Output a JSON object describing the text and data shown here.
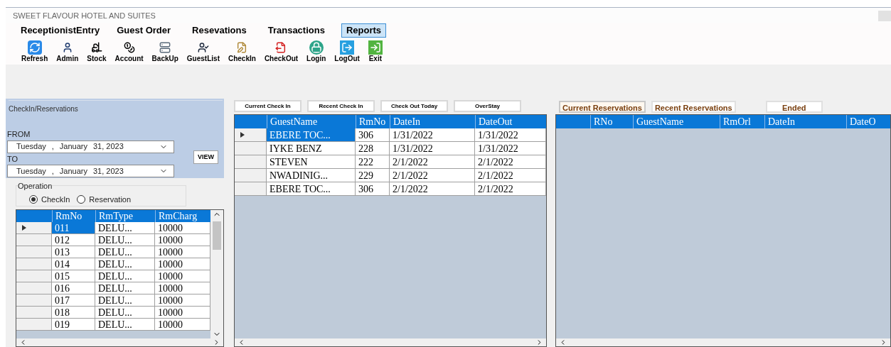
{
  "window": {
    "title": "SWEET FLAVOUR HOTEL AND SUITES"
  },
  "menu": [
    {
      "label": "ReceptionistEntry",
      "selected": false
    },
    {
      "label": "Guest Order",
      "selected": false
    },
    {
      "label": "Resevations",
      "selected": false
    },
    {
      "label": "Transactions",
      "selected": false
    },
    {
      "label": "Reports",
      "selected": true
    }
  ],
  "toolbar": [
    {
      "kind": "refresh",
      "label": "Refresh"
    },
    {
      "kind": "admin",
      "label": "Admin"
    },
    {
      "kind": "stock",
      "label": "Stock"
    },
    {
      "kind": "account",
      "label": "Account"
    },
    {
      "kind": "backup",
      "label": "BackUp"
    },
    {
      "kind": "guests",
      "label": "GuestList"
    },
    {
      "kind": "checkin",
      "label": "CheckIn"
    },
    {
      "kind": "checkout",
      "label": "CheckOut"
    },
    {
      "kind": "login",
      "label": "Login"
    },
    {
      "kind": "logout",
      "label": "LogOut"
    },
    {
      "kind": "exit",
      "label": "Exit"
    }
  ],
  "filter": {
    "title": "CheckIn/Reservations",
    "from_label": "FROM",
    "from": {
      "weekday": "Tuesday",
      "sep": ",",
      "month": "January",
      "day": "31, 2023"
    },
    "to_label": "TO",
    "to": {
      "weekday": "Tuesday",
      "sep": ",",
      "month": "January",
      "day": "31, 2023"
    },
    "view_button": "VIEW"
  },
  "operation": {
    "title": "Operation",
    "options": [
      {
        "label": "CheckIn",
        "selected": true
      },
      {
        "label": "Reservation",
        "selected": false
      }
    ]
  },
  "rooms": {
    "columns": [
      "RmNo",
      "RmType",
      "RmCharg"
    ],
    "rows": [
      {
        "selected": true,
        "cells": [
          "011",
          "DELU...",
          "10000"
        ]
      },
      {
        "selected": false,
        "cells": [
          "012",
          "DELU...",
          "10000"
        ]
      },
      {
        "selected": false,
        "cells": [
          "013",
          "DELU...",
          "10000"
        ]
      },
      {
        "selected": false,
        "cells": [
          "014",
          "DELU...",
          "10000"
        ]
      },
      {
        "selected": false,
        "cells": [
          "015",
          "DELU...",
          "10000"
        ]
      },
      {
        "selected": false,
        "cells": [
          "016",
          "DELU...",
          "10000"
        ]
      },
      {
        "selected": false,
        "cells": [
          "017",
          "DELU...",
          "10000"
        ]
      },
      {
        "selected": false,
        "cells": [
          "018",
          "DELU...",
          "10000"
        ]
      },
      {
        "selected": false,
        "cells": [
          "019",
          "DELU...",
          "10000"
        ]
      }
    ]
  },
  "checkin_tabs": [
    "Current Check In",
    "Recent Check In",
    "Check Out Today",
    "OverStay"
  ],
  "checkins": {
    "columns": [
      "GuestName",
      "RmNo",
      "DateIn",
      "DateOut"
    ],
    "rows": [
      {
        "selected": true,
        "cells": [
          "EBERE TOC...",
          "306",
          "1/31/2022",
          "1/31/2022"
        ]
      },
      {
        "selected": false,
        "cells": [
          "IYKE BENZ",
          "228",
          "1/31/2022",
          "1/31/2022"
        ]
      },
      {
        "selected": false,
        "cells": [
          "STEVEN",
          "222",
          "2/1/2022",
          "2/1/2022"
        ]
      },
      {
        "selected": false,
        "cells": [
          "NWADINIG...",
          "229",
          "2/1/2022",
          "2/1/2022"
        ]
      },
      {
        "selected": false,
        "cells": [
          "EBERE TOC...",
          "306",
          "2/1/2022",
          "2/1/2022"
        ]
      }
    ]
  },
  "reservation_tabs": [
    {
      "label": "Current Reservations",
      "selected": true
    },
    {
      "label": "Recent Reservations",
      "selected": false
    },
    {
      "label": "Ended",
      "selected": false
    }
  ],
  "reservations": {
    "columns": [
      "RNo",
      "GuestName",
      "RmOrl",
      "DateIn",
      "DateO"
    ]
  }
}
